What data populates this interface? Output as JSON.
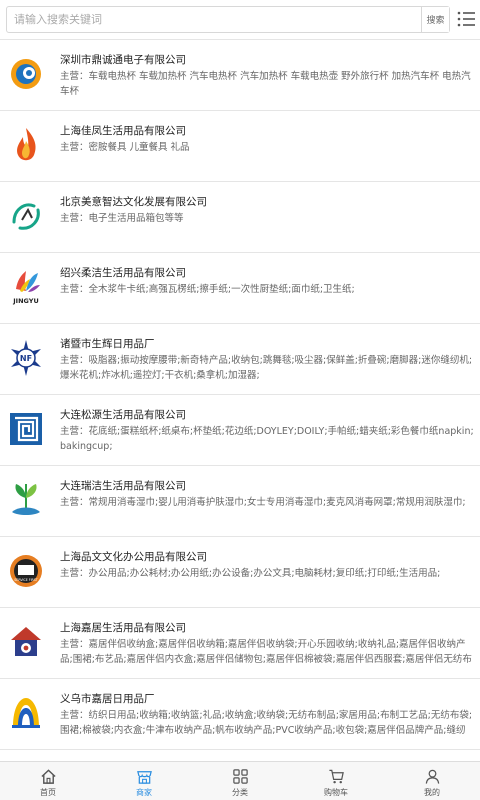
{
  "search": {
    "placeholder": "请输入搜索关键词",
    "button": "搜索"
  },
  "biz_prefix": "主营：",
  "companies": [
    {
      "name": "深圳市鼎诚通电子有限公司",
      "biz": "车载电热杯 车载加热杯 汽车电热杯 汽车加热杯 车载电热壶 野外旅行杯 加热汽车杯 电热汽车杯",
      "logo": "swirl-logo"
    },
    {
      "name": "上海佳凤生活用品有限公司",
      "biz": "密胺餐具 儿童餐具 礼品",
      "logo": "flame-logo"
    },
    {
      "name": "北京美意智达文化发展有限公司",
      "biz": "电子生活用品箱包等等",
      "logo": "ribbon-logo"
    },
    {
      "name": "绍兴柔洁生活用品有限公司",
      "biz": "全木浆牛卡纸;高强瓦楞纸;擦手纸;一次性厨垫纸;面巾纸;卫生纸;",
      "logo": "jingyu-logo",
      "logo_text": "JINGYU"
    },
    {
      "name": "诸暨市生辉日用品厂",
      "biz": "吸脂器;振动按摩腰带;新奇特产品;收纳包;跳舞毯;吸尘器;保鲜盖;折叠碗;磨脚器;迷你缝纫机;爆米花机;炸冰机;遥控灯;干衣机;桑拿机;加湿器;",
      "logo": "nf-logo",
      "logo_text": "NF"
    },
    {
      "name": "大连松源生活用品有限公司",
      "biz": "花底纸;蛋糕纸杯;纸桌布;杯垫纸;花边纸;DOYLEY;DOILY;手帕纸;蜡夹纸;彩色餐巾纸napkin;bakingcup;",
      "logo": "square-spiral-logo"
    },
    {
      "name": "大连瑞洁生活用品有限公司",
      "biz": "常规用消毒湿巾;婴儿用消毒护肤湿巾;女士专用消毒湿巾;麦克风消毒网罩;常规用润肤湿巾;",
      "logo": "plant-logo"
    },
    {
      "name": "上海品文文化办公用品有限公司",
      "biz": "办公用品;办公耗材;办公用纸;办公设备;办公文具;电脑耗材;复印纸;打印纸;生活用品;",
      "logo": "gear-badge-logo",
      "logo_text": "SERVICE FIRST"
    },
    {
      "name": "上海嘉居生活用品有限公司",
      "biz": "嘉居伴侣收纳盒;嘉居伴侣收纳箱;嘉居伴侣收纳袋;开心乐园收纳;收纳礼品;嘉居伴侣收纳产品;围裙;布艺品;嘉居伴侣内衣盒;嘉居伴侣储物包;嘉居伴侣棉被袋;嘉居伴侣西服套;嘉居伴侣无纺布布艺抽屉;嘉居...",
      "logo": "house-logo"
    },
    {
      "name": "义乌市嘉居日用品厂",
      "biz": "纺织日用品;收纳箱;收纳篮;礼品;收纳盒;收纳袋;无纺布制品;家居用品;布制工艺品;无纺布袋;围裙;棉被袋;内衣盒;牛津布收纳产品;帆布收纳产品;PVC收纳产品;收包袋;嘉居伴侣品牌产品;缝纫加工;各类包袋;",
      "logo": "arch-logo"
    }
  ],
  "tabs": [
    {
      "label": "首页",
      "icon": "home-icon",
      "active": false
    },
    {
      "label": "商家",
      "icon": "shop-icon",
      "active": true
    },
    {
      "label": "分类",
      "icon": "grid-icon",
      "active": false
    },
    {
      "label": "购物车",
      "icon": "cart-icon",
      "active": false
    },
    {
      "label": "我的",
      "icon": "user-icon",
      "active": false
    }
  ],
  "colors": {
    "accent": "#2a8de0",
    "text": "#222222",
    "muted": "#666666",
    "border": "#e5e5e5"
  }
}
